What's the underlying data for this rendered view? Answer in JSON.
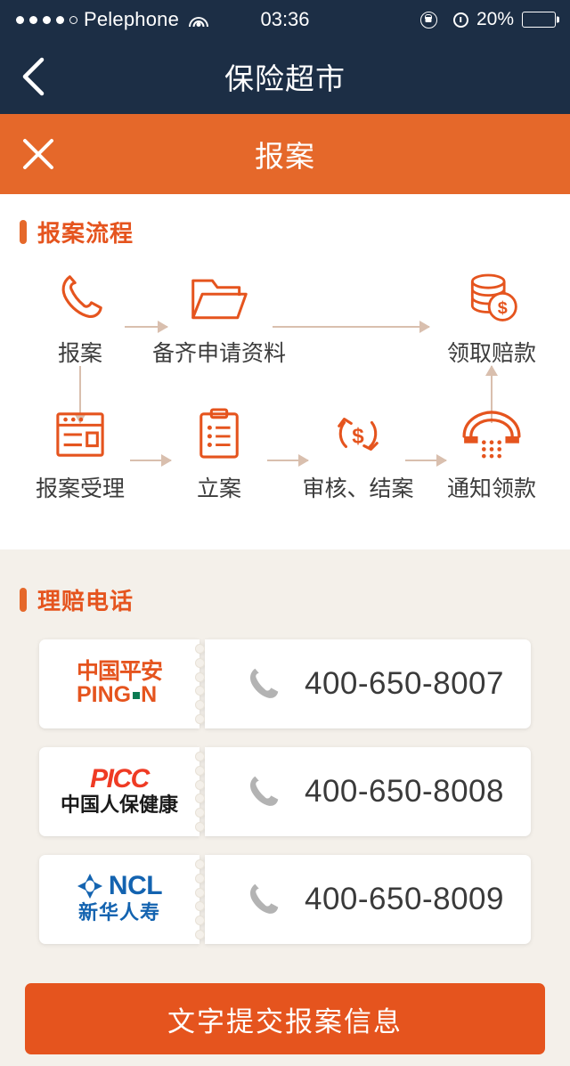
{
  "colors": {
    "navy": "#1c2e45",
    "orange": "#e5682a",
    "orange_dark": "#e5541e",
    "beige_bg": "#f4f0ea",
    "arrow": "#d9bfae",
    "picc_red": "#ef3b24",
    "ncl_blue": "#1363b0",
    "pingan_green": "#0a7b52"
  },
  "status_bar": {
    "carrier": "Pelephone",
    "signal_dots_total": 5,
    "signal_dots_filled": 4,
    "wifi_icon": "wifi-icon",
    "time": "03:36",
    "rotation_lock_icon": "rotation-lock-icon",
    "location_icon": "location-arrow-icon",
    "alarm_icon": "alarm-clock-icon",
    "battery_percent": "20%",
    "battery_level": 20,
    "battery_icon": "battery-icon"
  },
  "navbar": {
    "back_icon": "chevron-left-icon",
    "title": "保险超市"
  },
  "subheader": {
    "close_icon": "close-icon",
    "title": "报案"
  },
  "flow_section": {
    "heading": "报案流程",
    "nodes": [
      {
        "id": "report",
        "icon": "phone-handset-icon",
        "label": "报案"
      },
      {
        "id": "prepare-docs",
        "icon": "open-folder-icon",
        "label": "备齐申请资料"
      },
      {
        "id": "receive-claim",
        "icon": "coins-dollar-icon",
        "label": "领取赔款"
      },
      {
        "id": "accepted",
        "icon": "document-window-icon",
        "label": "报案受理"
      },
      {
        "id": "filed",
        "icon": "clipboard-list-icon",
        "label": "立案"
      },
      {
        "id": "review-close",
        "icon": "refresh-dollar-icon",
        "label": "审核、结案"
      },
      {
        "id": "notify-payout",
        "icon": "telephone-dial-icon",
        "label": "通知领款"
      }
    ]
  },
  "phone_section": {
    "heading": "理赔电话",
    "phone_icon": "phone-call-icon",
    "cards": [
      {
        "company_id": "pingan",
        "logo_icon": "pingan-logo",
        "logo_line1": "中国平安",
        "logo_line2_a": "PING",
        "logo_line2_b": "N",
        "phone": "400-650-8007"
      },
      {
        "company_id": "picc",
        "logo_icon": "picc-logo",
        "logo_line1": "PICC",
        "logo_line2": "中国人保健康",
        "phone": "400-650-8008"
      },
      {
        "company_id": "ncl",
        "logo_icon": "ncl-logo",
        "logo_line1": "NCL",
        "logo_line2": "新华人寿",
        "phone": "400-650-8009"
      }
    ]
  },
  "submit_button": {
    "label": "文字提交报案信息"
  }
}
